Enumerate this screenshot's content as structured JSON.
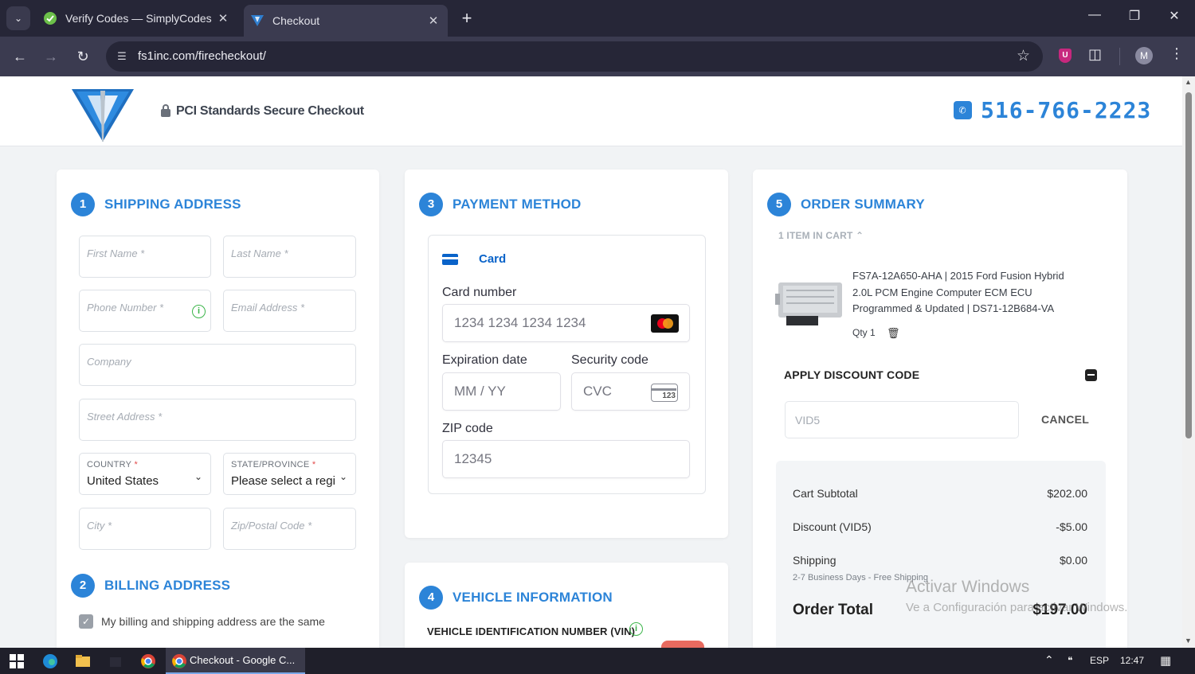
{
  "browser": {
    "tabs": [
      {
        "title": "Verify Codes — SimplyCodes",
        "active": false,
        "favicon": "check-circle-icon"
      },
      {
        "title": "Checkout",
        "active": true,
        "favicon": "fs1-logo-icon"
      }
    ],
    "url": "fs1inc.com/firecheckout/"
  },
  "header": {
    "secure_text": "PCI Standards Secure Checkout",
    "phone": "516-766-2223"
  },
  "shipping": {
    "number": "1",
    "title": "SHIPPING ADDRESS",
    "fields": {
      "first_name": "First Name *",
      "last_name": "Last Name *",
      "phone": "Phone Number *",
      "email": "Email Address *",
      "company": "Company",
      "street": "Street Address *",
      "country_label": "COUNTRY",
      "country_value": "United States",
      "state_label": "STATE/PROVINCE",
      "state_value": "Please select a region",
      "city": "City *",
      "zip": "Zip/Postal Code *"
    }
  },
  "billing": {
    "number": "2",
    "title": "BILLING ADDRESS",
    "same_label": "My billing and shipping address are the same",
    "same_checked": true
  },
  "payment": {
    "number": "3",
    "title": "PAYMENT METHOD",
    "tab_label": "Card",
    "card_number_label": "Card number",
    "card_number_placeholder": "1234 1234 1234 1234",
    "expiry_label": "Expiration date",
    "expiry_placeholder": "MM / YY",
    "cvc_label": "Security code",
    "cvc_placeholder": "CVC",
    "cvc_icon_text": "123",
    "zip_label": "ZIP code",
    "zip_placeholder": "12345"
  },
  "vehicle": {
    "number": "4",
    "title": "VEHICLE INFORMATION",
    "vin_label": "VEHICLE IDENTIFICATION NUMBER (VIN)"
  },
  "summary": {
    "number": "5",
    "title": "ORDER SUMMARY",
    "items_in_cart": "1 ITEM IN CART",
    "product_name": "FS7A-12A650-AHA | 2015 Ford Fusion Hybrid 2.0L PCM Engine Computer ECM ECU Programmed & Updated | DS71-12B684-VA",
    "qty": "Qty 1",
    "discount_heading": "APPLY DISCOUNT CODE",
    "discount_code": "VID5",
    "discount_cancel": "CANCEL",
    "totals": {
      "subtotal_label": "Cart Subtotal",
      "subtotal_value": "$202.00",
      "discount_label": "Discount (VID5)",
      "discount_value": "-$5.00",
      "shipping_label": "Shipping",
      "shipping_value": "$0.00",
      "shipping_note": "2-7 Business Days - Free Shipping",
      "order_total_label": "Order Total",
      "order_total_value": "$197.00"
    }
  },
  "watermark": {
    "line1": "Activar Windows",
    "line2": "Ve a Configuración para activar Windows."
  },
  "taskbar": {
    "active_app": "Checkout - Google C...",
    "lang": "ESP",
    "time": "12:47"
  },
  "colors": {
    "accent": "#2c84d8",
    "stripe_blue": "#0a63c9",
    "info_green": "#3cb54a"
  }
}
